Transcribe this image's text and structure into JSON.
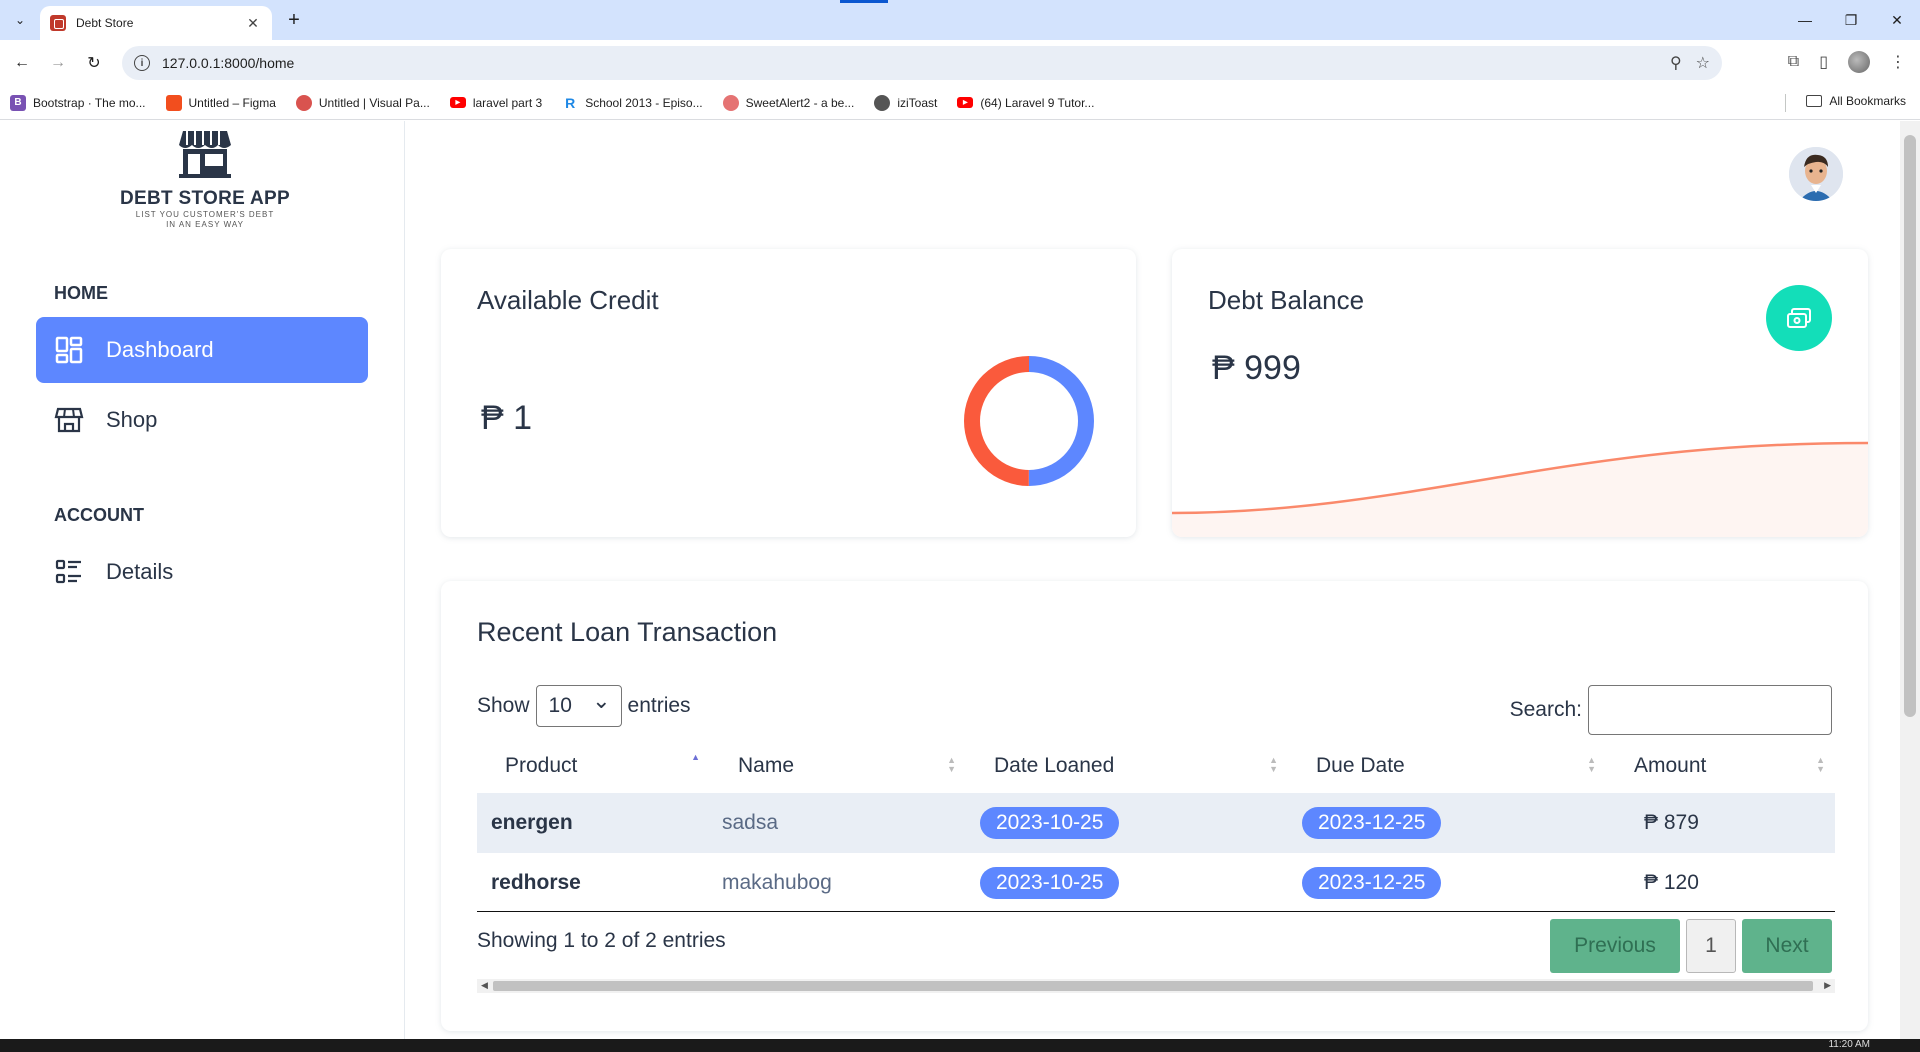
{
  "browser": {
    "tab_title": "Debt Store",
    "url": "127.0.0.1:8000/home",
    "bookmarks": [
      {
        "label": "Bootstrap · The mo...",
        "icon": "bootstrap-icon",
        "color": "#7952b3"
      },
      {
        "label": "Untitled – Figma",
        "icon": "figma-icon",
        "color": "#f24e1e"
      },
      {
        "label": "Untitled | Visual Pa...",
        "icon": "visual-paradigm-icon",
        "color": "#d9534f"
      },
      {
        "label": "laravel part 3",
        "icon": "youtube-icon",
        "color": "#ff0000"
      },
      {
        "label": "School 2013 - Episo...",
        "icon": "r-icon",
        "color": "#1e88e5"
      },
      {
        "label": "SweetAlert2 - a be...",
        "icon": "sweetalert-icon",
        "color": "#e57373"
      },
      {
        "label": "iziToast",
        "icon": "globe-icon",
        "color": "#555555"
      },
      {
        "label": "(64) Laravel 9 Tutor...",
        "icon": "youtube-icon",
        "color": "#ff0000"
      }
    ],
    "all_bookmarks": "All Bookmarks"
  },
  "sidebar": {
    "logo_title": "DEBT STORE APP",
    "logo_sub_1": "LIST YOU CUSTOMER'S DEBT",
    "logo_sub_2": "IN AN EASY WAY",
    "section_home": "HOME",
    "dashboard": "Dashboard",
    "shop": "Shop",
    "section_account": "ACCOUNT",
    "details": "Details"
  },
  "credit": {
    "title": "Available Credit",
    "value": "₱ 1",
    "donut": {
      "used_fraction": 0.5,
      "colors": [
        "#5d87ff",
        "#fa5a3c"
      ]
    }
  },
  "balance": {
    "title": "Debt Balance",
    "value": "₱ 999",
    "accent": "#13deb9",
    "line_color": "#fa896b"
  },
  "transactions": {
    "title": "Recent Loan Transaction",
    "show_label": "Show",
    "entries_value": "10",
    "entries_label": "entries",
    "search_label": "Search:",
    "columns": [
      "Product",
      "Name",
      "Date Loaned",
      "Due Date",
      "Amount"
    ],
    "rows": [
      {
        "product": "energen",
        "name": "sadsa",
        "date_loaned": "2023-10-25",
        "due_date": "2023-12-25",
        "amount": "₱ 879"
      },
      {
        "product": "redhorse",
        "name": "makahubog",
        "date_loaned": "2023-10-25",
        "due_date": "2023-12-25",
        "amount": "₱ 120"
      }
    ],
    "info": "Showing 1 to 2 of 2 entries",
    "prev": "Previous",
    "page": "1",
    "next": "Next"
  },
  "taskbar": {
    "clock": "11:20 AM"
  },
  "colors": {
    "primary": "#5d87ff",
    "success": "#13deb9",
    "danger": "#fa5a3c"
  }
}
